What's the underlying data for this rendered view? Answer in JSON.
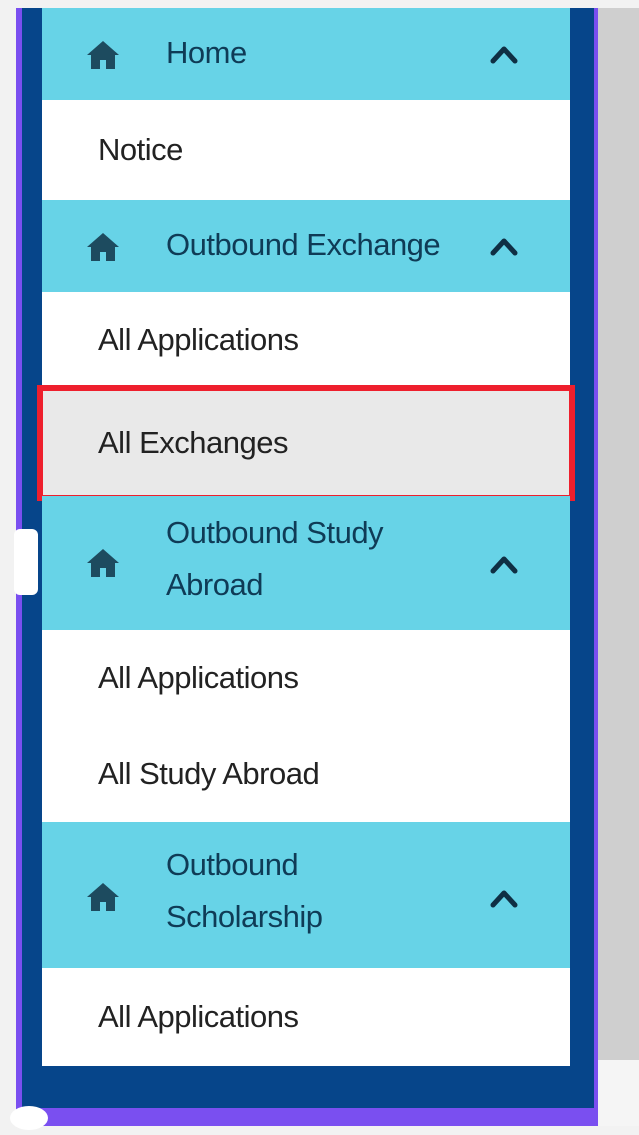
{
  "nav": {
    "sections": [
      {
        "title": "Home",
        "items": [
          "Notice"
        ]
      },
      {
        "title": "Outbound Exchange",
        "items": [
          "All Applications",
          "All Exchanges"
        ]
      },
      {
        "title_line1": "Outbound Study",
        "title_line2": "Abroad",
        "items": [
          "All Applications",
          "All Study Abroad"
        ]
      },
      {
        "title_line1": "Outbound",
        "title_line2": "Scholarship",
        "items": [
          "All Applications"
        ]
      }
    ],
    "selected_item": "All Exchanges",
    "icons": {
      "section": "home-icon",
      "toggle": "chevron-up-icon"
    }
  },
  "colors": {
    "header_bg": "#67d3e7",
    "nav_frame": "#06458a",
    "highlight_border": "#ee1f2d",
    "selected_bg": "#e9e9e9"
  }
}
